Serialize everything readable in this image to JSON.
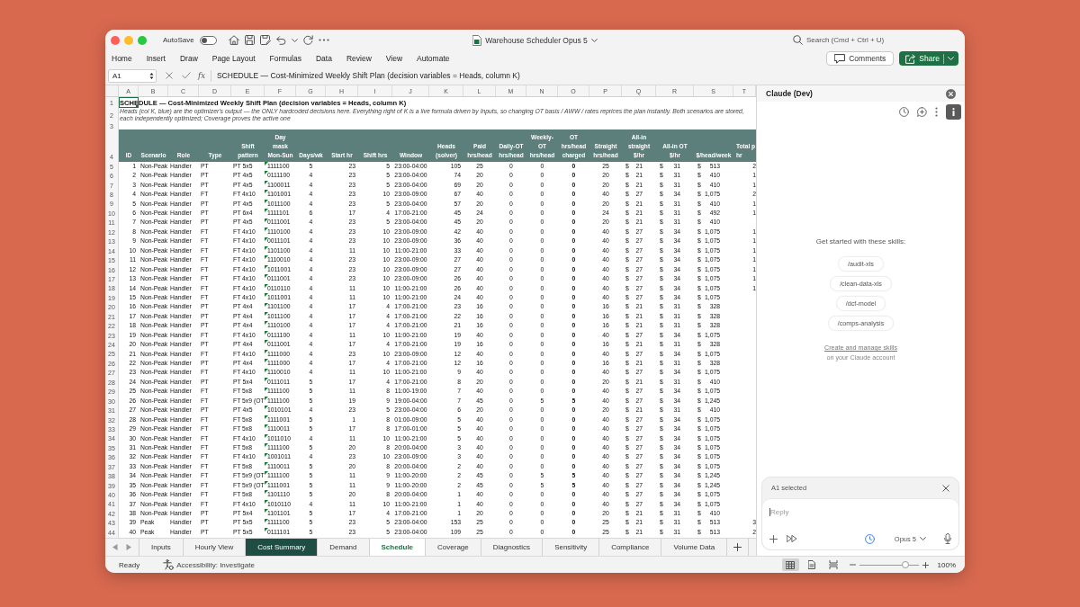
{
  "window": {
    "title": "Warehouse Scheduler Opus 5",
    "autosave": {
      "label": "AutoSave",
      "on": false
    },
    "search": {
      "placeholder": "Search (Cmd + Ctrl + U)"
    }
  },
  "ribbon": {
    "tabs": [
      "Home",
      "Insert",
      "Draw",
      "Page Layout",
      "Formulas",
      "Data",
      "Review",
      "View",
      "Automate"
    ],
    "comments": "Comments",
    "share": "Share"
  },
  "formula_bar": {
    "name_box": "A1",
    "function_label": "fx",
    "formula": "SCHEDULE — Cost-Minimized Weekly Shift Plan (decision variables = Heads, column K)"
  },
  "sheet": {
    "column_letters": [
      "A",
      "B",
      "C",
      "D",
      "E",
      "F",
      "G",
      "H",
      "I",
      "J",
      "K",
      "L",
      "M",
      "N",
      "O",
      "P",
      "Q",
      "R",
      "S",
      "T"
    ],
    "title": {
      "row": "1",
      "text": "SCHEDULE — Cost-Minimized Weekly Shift Plan (decision variables = Heads, column K)",
      "selected": true
    },
    "note": {
      "row": "2",
      "text": "Heads (col K, blue) are the optimizer's output — the ONLY hardcoded decisions here. Everything right of K is a live formula driven by Inputs, so changing OT basis / AWW / rates reprices the plan instantly. Both scenarios are stored, each independently optimized; Coverage proves the active one"
    },
    "blank_rows": [
      "3"
    ],
    "header_row": "4",
    "columns": [
      {
        "label": "ID",
        "kind": "right"
      },
      {
        "label": "Scenario",
        "kind": "text"
      },
      {
        "label": "Role",
        "kind": "text"
      },
      {
        "label": "Type",
        "kind": "text"
      },
      {
        "label": "Shift\npattern",
        "kind": "text"
      },
      {
        "label": "Day\nmask\nMon-Sun",
        "kind": "flagged"
      },
      {
        "label": "Days/wk",
        "kind": "center"
      },
      {
        "label": "Start hr",
        "kind": "right"
      },
      {
        "label": "Shift hrs",
        "kind": "right"
      },
      {
        "label": "Window",
        "kind": "center"
      },
      {
        "label": "Heads\n(solver)",
        "kind": "right"
      },
      {
        "label": "Paid\nhrs/head",
        "kind": "center"
      },
      {
        "label": "Daily-OT\nhrs/head",
        "kind": "center"
      },
      {
        "label": "Weekly-\nOT\nhrs/head",
        "kind": "center"
      },
      {
        "label": "OT\nhrs/head\ncharged",
        "kind": "bold"
      },
      {
        "label": "Straight\nhrs/head",
        "kind": "center"
      },
      {
        "label": "All-in\nstraight\n$/hr",
        "kind": "currency"
      },
      {
        "label": "All-in OT\n$/hr",
        "kind": "currency"
      },
      {
        "label": "$/head/week",
        "kind": "currency"
      },
      {
        "label": "Total p\nhr",
        "kind": "clipped"
      }
    ],
    "rows": [
      {
        "row": "5",
        "cells": [
          "1",
          "Non-Peak",
          "Handler",
          "PT",
          "PT 5x5",
          "1111100",
          "5",
          "23",
          "5",
          "23:00-04:00",
          "105",
          "25",
          "0",
          "0",
          "0",
          "25",
          [
            "$",
            "21"
          ],
          [
            "$",
            "31"
          ],
          [
            "$",
            "513"
          ],
          "2"
        ]
      },
      {
        "row": "6",
        "cells": [
          "2",
          "Non-Peak",
          "Handler",
          "PT",
          "PT 4x5",
          "0111100",
          "4",
          "23",
          "5",
          "23:00-04:00",
          "74",
          "20",
          "0",
          "0",
          "0",
          "20",
          [
            "$",
            "21"
          ],
          [
            "$",
            "31"
          ],
          [
            "$",
            "410"
          ],
          "1"
        ]
      },
      {
        "row": "7",
        "cells": [
          "3",
          "Non-Peak",
          "Handler",
          "PT",
          "PT 4x5",
          "1100011",
          "4",
          "23",
          "5",
          "23:00-04:00",
          "69",
          "20",
          "0",
          "0",
          "0",
          "20",
          [
            "$",
            "21"
          ],
          [
            "$",
            "31"
          ],
          [
            "$",
            "410"
          ],
          "1"
        ]
      },
      {
        "row": "8",
        "cells": [
          "4",
          "Non-Peak",
          "Handler",
          "FT",
          "FT 4x10",
          "1101001",
          "4",
          "23",
          "10",
          "23:00-09:00",
          "67",
          "40",
          "0",
          "0",
          "0",
          "40",
          [
            "$",
            "27"
          ],
          [
            "$",
            "34"
          ],
          [
            "$",
            "1,075"
          ],
          "2"
        ]
      },
      {
        "row": "9",
        "cells": [
          "5",
          "Non-Peak",
          "Handler",
          "PT",
          "PT 4x5",
          "1011100",
          "4",
          "23",
          "5",
          "23:00-04:00",
          "57",
          "20",
          "0",
          "0",
          "0",
          "20",
          [
            "$",
            "21"
          ],
          [
            "$",
            "31"
          ],
          [
            "$",
            "410"
          ],
          "1"
        ]
      },
      {
        "row": "10",
        "cells": [
          "6",
          "Non-Peak",
          "Handler",
          "PT",
          "PT 6x4",
          "1111101",
          "6",
          "17",
          "4",
          "17:00-21:00",
          "45",
          "24",
          "0",
          "0",
          "0",
          "24",
          [
            "$",
            "21"
          ],
          [
            "$",
            "31"
          ],
          [
            "$",
            "492"
          ],
          "1"
        ]
      },
      {
        "row": "11",
        "cells": [
          "7",
          "Non-Peak",
          "Handler",
          "PT",
          "PT 4x5",
          "0111001",
          "4",
          "23",
          "5",
          "23:00-04:00",
          "45",
          "20",
          "0",
          "0",
          "0",
          "20",
          [
            "$",
            "21"
          ],
          [
            "$",
            "31"
          ],
          [
            "$",
            "410"
          ]
        ]
      },
      {
        "row": "12",
        "cells": [
          "8",
          "Non-Peak",
          "Handler",
          "FT",
          "FT 4x10",
          "1110100",
          "4",
          "23",
          "10",
          "23:00-09:00",
          "42",
          "40",
          "0",
          "0",
          "0",
          "40",
          [
            "$",
            "27"
          ],
          [
            "$",
            "34"
          ],
          [
            "$",
            "1,075"
          ],
          "1"
        ]
      },
      {
        "row": "13",
        "cells": [
          "9",
          "Non-Peak",
          "Handler",
          "FT",
          "FT 4x10",
          "0011101",
          "4",
          "23",
          "10",
          "23:00-09:00",
          "36",
          "40",
          "0",
          "0",
          "0",
          "40",
          [
            "$",
            "27"
          ],
          [
            "$",
            "34"
          ],
          [
            "$",
            "1,075"
          ],
          "1"
        ]
      },
      {
        "row": "14",
        "cells": [
          "10",
          "Non-Peak",
          "Handler",
          "FT",
          "FT 4x10",
          "1101100",
          "4",
          "11",
          "10",
          "11:00-21:00",
          "33",
          "40",
          "0",
          "0",
          "0",
          "40",
          [
            "$",
            "27"
          ],
          [
            "$",
            "34"
          ],
          [
            "$",
            "1,075"
          ],
          "1"
        ]
      },
      {
        "row": "15",
        "cells": [
          "11",
          "Non-Peak",
          "Handler",
          "FT",
          "FT 4x10",
          "1110010",
          "4",
          "23",
          "10",
          "23:00-09:00",
          "27",
          "40",
          "0",
          "0",
          "0",
          "40",
          [
            "$",
            "27"
          ],
          [
            "$",
            "34"
          ],
          [
            "$",
            "1,075"
          ],
          "1"
        ]
      },
      {
        "row": "16",
        "cells": [
          "12",
          "Non-Peak",
          "Handler",
          "FT",
          "FT 4x10",
          "1011001",
          "4",
          "23",
          "10",
          "23:00-09:00",
          "27",
          "40",
          "0",
          "0",
          "0",
          "40",
          [
            "$",
            "27"
          ],
          [
            "$",
            "34"
          ],
          [
            "$",
            "1,075"
          ],
          "1"
        ]
      },
      {
        "row": "17",
        "cells": [
          "13",
          "Non-Peak",
          "Handler",
          "FT",
          "FT 4x10",
          "0111001",
          "4",
          "23",
          "10",
          "23:00-09:00",
          "26",
          "40",
          "0",
          "0",
          "0",
          "40",
          [
            "$",
            "27"
          ],
          [
            "$",
            "34"
          ],
          [
            "$",
            "1,075"
          ],
          "1"
        ]
      },
      {
        "row": "18",
        "cells": [
          "14",
          "Non-Peak",
          "Handler",
          "FT",
          "FT 4x10",
          "0110110",
          "4",
          "11",
          "10",
          "11:00-21:00",
          "26",
          "40",
          "0",
          "0",
          "0",
          "40",
          [
            "$",
            "27"
          ],
          [
            "$",
            "34"
          ],
          [
            "$",
            "1,075"
          ],
          "1"
        ]
      },
      {
        "row": "19",
        "cells": [
          "15",
          "Non-Peak",
          "Handler",
          "FT",
          "FT 4x10",
          "1011001",
          "4",
          "11",
          "10",
          "11:00-21:00",
          "24",
          "40",
          "0",
          "0",
          "0",
          "40",
          [
            "$",
            "27"
          ],
          [
            "$",
            "34"
          ],
          [
            "$",
            "1,075"
          ]
        ]
      },
      {
        "row": "20",
        "cells": [
          "16",
          "Non-Peak",
          "Handler",
          "PT",
          "PT 4x4",
          "1101100",
          "4",
          "17",
          "4",
          "17:00-21:00",
          "23",
          "16",
          "0",
          "0",
          "0",
          "16",
          [
            "$",
            "21"
          ],
          [
            "$",
            "31"
          ],
          [
            "$",
            "328"
          ]
        ]
      },
      {
        "row": "21",
        "cells": [
          "17",
          "Non-Peak",
          "Handler",
          "PT",
          "PT 4x4",
          "1011100",
          "4",
          "17",
          "4",
          "17:00-21:00",
          "22",
          "16",
          "0",
          "0",
          "0",
          "16",
          [
            "$",
            "21"
          ],
          [
            "$",
            "31"
          ],
          [
            "$",
            "328"
          ]
        ]
      },
      {
        "row": "22",
        "cells": [
          "18",
          "Non-Peak",
          "Handler",
          "PT",
          "PT 4x4",
          "1110100",
          "4",
          "17",
          "4",
          "17:00-21:00",
          "21",
          "16",
          "0",
          "0",
          "0",
          "16",
          [
            "$",
            "21"
          ],
          [
            "$",
            "31"
          ],
          [
            "$",
            "328"
          ]
        ]
      },
      {
        "row": "23",
        "cells": [
          "19",
          "Non-Peak",
          "Handler",
          "FT",
          "FT 4x10",
          "0111100",
          "4",
          "11",
          "10",
          "11:00-21:00",
          "19",
          "40",
          "0",
          "0",
          "0",
          "40",
          [
            "$",
            "27"
          ],
          [
            "$",
            "34"
          ],
          [
            "$",
            "1,075"
          ]
        ]
      },
      {
        "row": "24",
        "cells": [
          "20",
          "Non-Peak",
          "Handler",
          "PT",
          "PT 4x4",
          "0111001",
          "4",
          "17",
          "4",
          "17:00-21:00",
          "19",
          "16",
          "0",
          "0",
          "0",
          "16",
          [
            "$",
            "21"
          ],
          [
            "$",
            "31"
          ],
          [
            "$",
            "328"
          ]
        ]
      },
      {
        "row": "25",
        "cells": [
          "21",
          "Non-Peak",
          "Handler",
          "FT",
          "FT 4x10",
          "1111000",
          "4",
          "23",
          "10",
          "23:00-09:00",
          "12",
          "40",
          "0",
          "0",
          "0",
          "40",
          [
            "$",
            "27"
          ],
          [
            "$",
            "34"
          ],
          [
            "$",
            "1,075"
          ]
        ]
      },
      {
        "row": "26",
        "cells": [
          "22",
          "Non-Peak",
          "Handler",
          "PT",
          "PT 4x4",
          "1111000",
          "4",
          "17",
          "4",
          "17:00-21:00",
          "12",
          "16",
          "0",
          "0",
          "0",
          "16",
          [
            "$",
            "21"
          ],
          [
            "$",
            "31"
          ],
          [
            "$",
            "328"
          ]
        ]
      },
      {
        "row": "27",
        "cells": [
          "23",
          "Non-Peak",
          "Handler",
          "FT",
          "FT 4x10",
          "1110010",
          "4",
          "11",
          "10",
          "11:00-21:00",
          "9",
          "40",
          "0",
          "0",
          "0",
          "40",
          [
            "$",
            "27"
          ],
          [
            "$",
            "34"
          ],
          [
            "$",
            "1,075"
          ]
        ]
      },
      {
        "row": "28",
        "cells": [
          "24",
          "Non-Peak",
          "Handler",
          "PT",
          "PT 5x4",
          "0111011",
          "5",
          "17",
          "4",
          "17:00-21:00",
          "8",
          "20",
          "0",
          "0",
          "0",
          "20",
          [
            "$",
            "21"
          ],
          [
            "$",
            "31"
          ],
          [
            "$",
            "410"
          ]
        ]
      },
      {
        "row": "29",
        "cells": [
          "25",
          "Non-Peak",
          "Handler",
          "FT",
          "FT 5x8",
          "1111100",
          "5",
          "11",
          "8",
          "11:00-19:00",
          "7",
          "40",
          "0",
          "0",
          "0",
          "40",
          [
            "$",
            "27"
          ],
          [
            "$",
            "34"
          ],
          [
            "$",
            "1,075"
          ]
        ]
      },
      {
        "row": "30",
        "cells": [
          "26",
          "Non-Peak",
          "Handler",
          "FT",
          "FT 5x9 (OT",
          "1111100",
          "5",
          "19",
          "9",
          "19:00-04:00",
          "7",
          "45",
          "0",
          "5",
          "5",
          "40",
          [
            "$",
            "27"
          ],
          [
            "$",
            "34"
          ],
          [
            "$",
            "1,245"
          ]
        ]
      },
      {
        "row": "31",
        "cells": [
          "27",
          "Non-Peak",
          "Handler",
          "PT",
          "PT 4x5",
          "1010101",
          "4",
          "23",
          "5",
          "23:00-04:00",
          "6",
          "20",
          "0",
          "0",
          "0",
          "20",
          [
            "$",
            "21"
          ],
          [
            "$",
            "31"
          ],
          [
            "$",
            "410"
          ]
        ]
      },
      {
        "row": "32",
        "cells": [
          "28",
          "Non-Peak",
          "Handler",
          "FT",
          "FT 5x8",
          "1111001",
          "5",
          "1",
          "8",
          "01:00-09:00",
          "5",
          "40",
          "0",
          "0",
          "0",
          "40",
          [
            "$",
            "27"
          ],
          [
            "$",
            "34"
          ],
          [
            "$",
            "1,075"
          ]
        ]
      },
      {
        "row": "33",
        "cells": [
          "29",
          "Non-Peak",
          "Handler",
          "FT",
          "FT 5x8",
          "1110011",
          "5",
          "17",
          "8",
          "17:00-01:00",
          "5",
          "40",
          "0",
          "0",
          "0",
          "40",
          [
            "$",
            "27"
          ],
          [
            "$",
            "34"
          ],
          [
            "$",
            "1,075"
          ]
        ]
      },
      {
        "row": "34",
        "cells": [
          "30",
          "Non-Peak",
          "Handler",
          "FT",
          "FT 4x10",
          "1011010",
          "4",
          "11",
          "10",
          "11:00-21:00",
          "5",
          "40",
          "0",
          "0",
          "0",
          "40",
          [
            "$",
            "27"
          ],
          [
            "$",
            "34"
          ],
          [
            "$",
            "1,075"
          ]
        ]
      },
      {
        "row": "35",
        "cells": [
          "31",
          "Non-Peak",
          "Handler",
          "FT",
          "FT 5x8",
          "1111100",
          "5",
          "20",
          "8",
          "20:00-04:00",
          "3",
          "40",
          "0",
          "0",
          "0",
          "40",
          [
            "$",
            "27"
          ],
          [
            "$",
            "34"
          ],
          [
            "$",
            "1,075"
          ]
        ]
      },
      {
        "row": "36",
        "cells": [
          "32",
          "Non-Peak",
          "Handler",
          "FT",
          "FT 4x10",
          "1001011",
          "4",
          "23",
          "10",
          "23:00-09:00",
          "3",
          "40",
          "0",
          "0",
          "0",
          "40",
          [
            "$",
            "27"
          ],
          [
            "$",
            "34"
          ],
          [
            "$",
            "1,075"
          ]
        ]
      },
      {
        "row": "37",
        "cells": [
          "33",
          "Non-Peak",
          "Handler",
          "FT",
          "FT 5x8",
          "1110011",
          "5",
          "20",
          "8",
          "20:00-04:00",
          "2",
          "40",
          "0",
          "0",
          "0",
          "40",
          [
            "$",
            "27"
          ],
          [
            "$",
            "34"
          ],
          [
            "$",
            "1,075"
          ]
        ]
      },
      {
        "row": "38",
        "cells": [
          "34",
          "Non-Peak",
          "Handler",
          "FT",
          "FT 5x9 (OT",
          "1111100",
          "5",
          "11",
          "9",
          "11:00-20:00",
          "2",
          "45",
          "0",
          "5",
          "5",
          "40",
          [
            "$",
            "27"
          ],
          [
            "$",
            "34"
          ],
          [
            "$",
            "1,245"
          ]
        ]
      },
      {
        "row": "39",
        "cells": [
          "35",
          "Non-Peak",
          "Handler",
          "FT",
          "FT 5x9 (OT",
          "1111001",
          "5",
          "11",
          "9",
          "11:00-20:00",
          "2",
          "45",
          "0",
          "5",
          "5",
          "40",
          [
            "$",
            "27"
          ],
          [
            "$",
            "34"
          ],
          [
            "$",
            "1,245"
          ]
        ]
      },
      {
        "row": "40",
        "cells": [
          "36",
          "Non-Peak",
          "Handler",
          "FT",
          "FT 5x8",
          "1101110",
          "5",
          "20",
          "8",
          "20:00-04:00",
          "1",
          "40",
          "0",
          "0",
          "0",
          "40",
          [
            "$",
            "27"
          ],
          [
            "$",
            "34"
          ],
          [
            "$",
            "1,075"
          ]
        ]
      },
      {
        "row": "41",
        "cells": [
          "37",
          "Non-Peak",
          "Handler",
          "FT",
          "FT 4x10",
          "1010110",
          "4",
          "11",
          "10",
          "11:00-21:00",
          "1",
          "40",
          "0",
          "0",
          "0",
          "40",
          [
            "$",
            "27"
          ],
          [
            "$",
            "34"
          ],
          [
            "$",
            "1,075"
          ]
        ]
      },
      {
        "row": "42",
        "cells": [
          "38",
          "Non-Peak",
          "Handler",
          "PT",
          "PT 5x4",
          "1101101",
          "5",
          "17",
          "4",
          "17:00-21:00",
          "1",
          "20",
          "0",
          "0",
          "0",
          "20",
          [
            "$",
            "21"
          ],
          [
            "$",
            "31"
          ],
          [
            "$",
            "410"
          ]
        ]
      },
      {
        "row": "43",
        "cells": [
          "39",
          "Peak",
          "Handler",
          "PT",
          "PT 5x5",
          "1111100",
          "5",
          "23",
          "5",
          "23:00-04:00",
          "153",
          "25",
          "0",
          "0",
          "0",
          "25",
          [
            "$",
            "21"
          ],
          [
            "$",
            "31"
          ],
          [
            "$",
            "513"
          ],
          "3"
        ]
      },
      {
        "row": "44",
        "cells": [
          "40",
          "Peak",
          "Handler",
          "PT",
          "PT 5x5",
          "0111101",
          "5",
          "23",
          "5",
          "23:00-04:00",
          "109",
          "25",
          "0",
          "0",
          "0",
          "25",
          [
            "$",
            "21"
          ],
          [
            "$",
            "31"
          ],
          [
            "$",
            "513"
          ],
          "2"
        ]
      }
    ]
  },
  "sheet_tabs": [
    {
      "label": "Inputs",
      "selected": false
    },
    {
      "label": "Hourly View",
      "selected": false
    },
    {
      "label": "Cost Summary",
      "selected": false,
      "color": "#1e4d43"
    },
    {
      "label": "Demand",
      "selected": false
    },
    {
      "label": "Schedule",
      "selected": true
    },
    {
      "label": "Coverage",
      "selected": false
    },
    {
      "label": "Diagnostics",
      "selected": false
    },
    {
      "label": "Sensitivity",
      "selected": false
    },
    {
      "label": "Compliance",
      "selected": false
    },
    {
      "label": "Volume Data",
      "selected": false
    }
  ],
  "status_bar": {
    "status": "Ready",
    "accessibility": "Accessibility: Investigate",
    "views": [
      {
        "kind": "normal",
        "selected": true
      },
      {
        "kind": "page_layout",
        "selected": false
      },
      {
        "kind": "page_break",
        "selected": false
      }
    ],
    "zoom": {
      "level": 0.78,
      "reading": "100%"
    }
  },
  "assistant_panel": {
    "title": "Claude (Dev)",
    "prompt": "Get started with these skills:",
    "skills": [
      "/audit-xls",
      "/clean-data-xls",
      "/dcf-model",
      "/comps-analysis"
    ],
    "link": "Create and manage skills",
    "link_note": "on your Claude account",
    "context": "A1 selected",
    "reply": {
      "placeholder": "Reply",
      "focused": true
    },
    "model": "Opus 5"
  }
}
